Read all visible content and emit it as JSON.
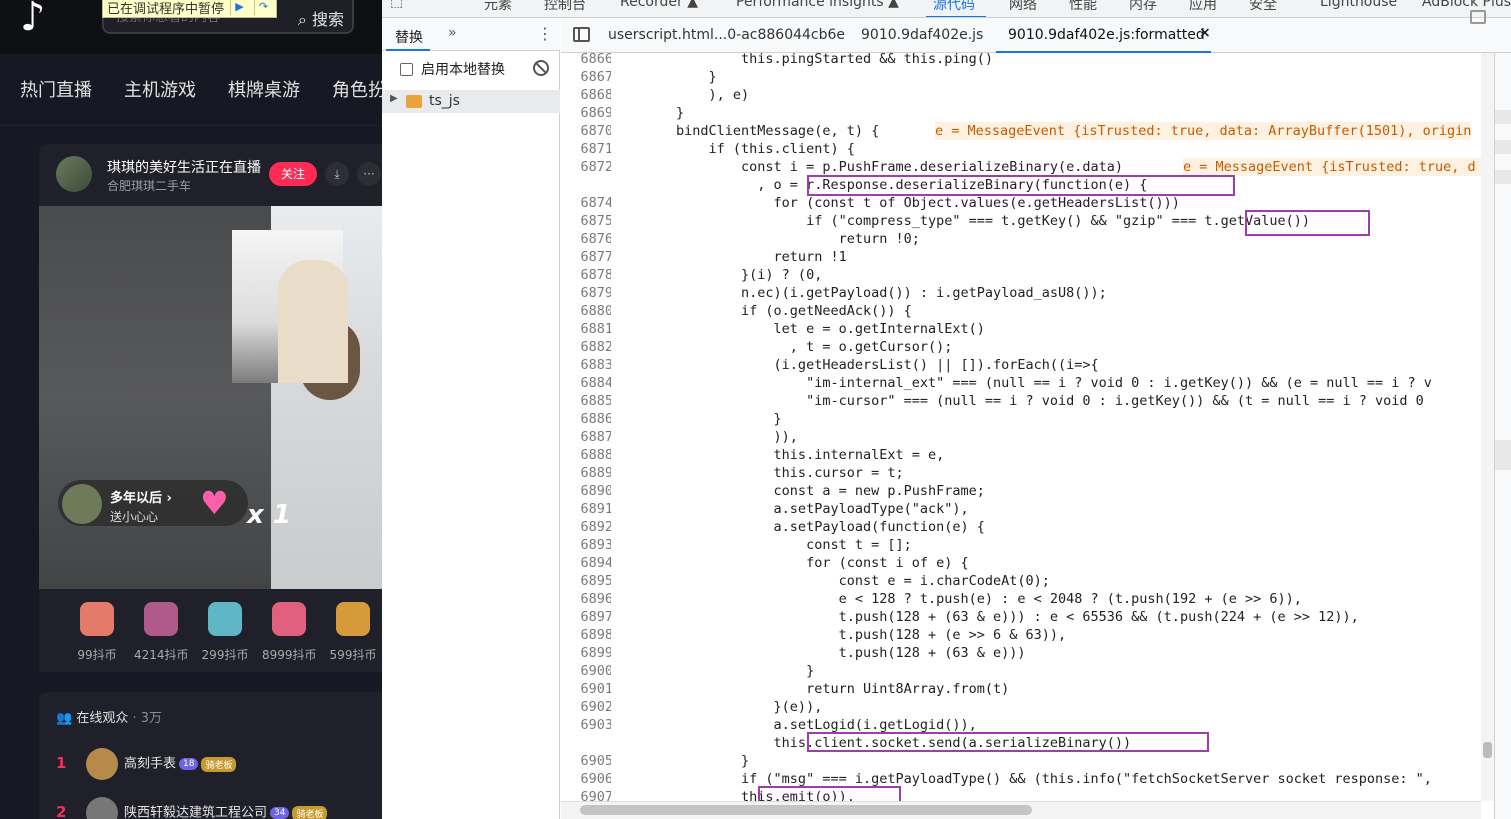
{
  "douyin": {
    "search_placeholder": "搜索你想看的内容",
    "search_button": "搜索",
    "debugger_paused": "已在调试程序中暂停",
    "categories": [
      "热门直播",
      "主机游戏",
      "棋牌桌游",
      "角色扮"
    ],
    "anchor_name": "琪琪的美好生活正在直播",
    "anchor_sub": "合肥琪琪二手车",
    "follow": "关注",
    "gift_bubble": {
      "name": "多年以后 ›",
      "sub": "送小心心",
      "multiplier": "x 1"
    },
    "gifts": [
      "99抖币",
      "4214抖币",
      "299抖币",
      "8999抖币",
      "599抖币"
    ],
    "audience_title": "在线观众",
    "audience_count": "· 3万",
    "audience": [
      {
        "rank": "1",
        "name": "高刻手表",
        "lv": "18",
        "badge": "骑老板"
      },
      {
        "rank": "2",
        "name": "陕西轩毅达建筑工程公司",
        "lv": "34",
        "badge": "骑老板"
      }
    ]
  },
  "devtools": {
    "top_tabs": [
      "元素",
      "控制台",
      "Recorder ▲",
      "Performance insights ▲",
      "源代码",
      "网络",
      "性能",
      "内存",
      "应用",
      "安全",
      "Lighthouse",
      "AdBlock Plus"
    ],
    "active_top_tab": "源代码",
    "navigator": {
      "tab": "替换",
      "more": "»",
      "enable_override": "启用本地替换",
      "folder": "ts_js"
    },
    "file_tabs": [
      "userscript.html...0-ac886044cb6e",
      "9010.9daf402e.js",
      "9010.9daf402e.js:formatted"
    ],
    "close_glyph": "×",
    "inline_values": {
      "6870": "e = MessageEvent {isTrusted: true, data: ArrayBuffer(1501), origin",
      "6872": "e = MessageEvent {isTrusted: true, d"
    },
    "breakpoints": [
      "6873",
      "6904"
    ],
    "code_lines": [
      {
        "n": "6866",
        "t": "                this.pingStarted && this.ping()"
      },
      {
        "n": "6867",
        "t": "            }"
      },
      {
        "n": "6868",
        "t": "            ), e)"
      },
      {
        "n": "6869",
        "t": "        }"
      },
      {
        "n": "6870",
        "t": "        bindClientMessage(e, t) {"
      },
      {
        "n": "6871",
        "t": "            if (this.client) {"
      },
      {
        "n": "6872",
        "t": "                const i = p.PushFrame.deserializeBinary(e.data)"
      },
      {
        "n": "6873",
        "t": "                  , o = r.Response.deserializeBinary(function(e) {"
      },
      {
        "n": "6874",
        "t": "                    for (const t of Object.values(e.getHeadersList()))"
      },
      {
        "n": "6875",
        "t": "                        if (\"compress_type\" === t.getKey() && \"gzip\" === t.getValue())"
      },
      {
        "n": "6876",
        "t": "                            return !0;"
      },
      {
        "n": "6877",
        "t": "                    return !1"
      },
      {
        "n": "6878",
        "t": "                }(i) ? (0,"
      },
      {
        "n": "6879",
        "t": "                n.ec)(i.getPayload()) : i.getPayload_asU8());"
      },
      {
        "n": "6880",
        "t": "                if (o.getNeedAck()) {"
      },
      {
        "n": "6881",
        "t": "                    let e = o.getInternalExt()"
      },
      {
        "n": "6882",
        "t": "                      , t = o.getCursor();"
      },
      {
        "n": "6883",
        "t": "                    (i.getHeadersList() || []).forEach((i=>{"
      },
      {
        "n": "6884",
        "t": "                        \"im-internal_ext\" === (null == i ? void 0 : i.getKey()) && (e = null == i ? v"
      },
      {
        "n": "6885",
        "t": "                        \"im-cursor\" === (null == i ? void 0 : i.getKey()) && (t = null == i ? void 0"
      },
      {
        "n": "6886",
        "t": "                    }"
      },
      {
        "n": "6887",
        "t": "                    )),"
      },
      {
        "n": "6888",
        "t": "                    this.internalExt = e,"
      },
      {
        "n": "6889",
        "t": "                    this.cursor = t;"
      },
      {
        "n": "6890",
        "t": "                    const a = new p.PushFrame;"
      },
      {
        "n": "6891",
        "t": "                    a.setPayloadType(\"ack\"),"
      },
      {
        "n": "6892",
        "t": "                    a.setPayload(function(e) {"
      },
      {
        "n": "6893",
        "t": "                        const t = [];"
      },
      {
        "n": "6894",
        "t": "                        for (const i of e) {"
      },
      {
        "n": "6895",
        "t": "                            const e = i.charCodeAt(0);"
      },
      {
        "n": "6896",
        "t": "                            e < 128 ? t.push(e) : e < 2048 ? (t.push(192 + (e >> 6)),"
      },
      {
        "n": "6897",
        "t": "                            t.push(128 + (63 & e))) : e < 65536 && (t.push(224 + (e >> 12)),"
      },
      {
        "n": "6898",
        "t": "                            t.push(128 + (e >> 6 & 63)),"
      },
      {
        "n": "6899",
        "t": "                            t.push(128 + (63 & e)))"
      },
      {
        "n": "6900",
        "t": "                        }"
      },
      {
        "n": "6901",
        "t": "                        return Uint8Array.from(t)"
      },
      {
        "n": "6902",
        "t": "                    }(e)),"
      },
      {
        "n": "6903",
        "t": "                    a.setLogid(i.getLogid()),"
      },
      {
        "n": "6904",
        "t": "                    this.client.socket.send(a.serializeBinary())"
      },
      {
        "n": "6905",
        "t": "                }"
      },
      {
        "n": "6906",
        "t": "                if (\"msg\" === i.getPayloadType() && (this.info(\"fetchSocketServer socket response: \","
      },
      {
        "n": "6907",
        "t": "                this.emit(o)),"
      }
    ],
    "colors": {
      "accent": "#1a73e8",
      "annotation_box": "#a13caf",
      "inline_value": "#c75b00"
    }
  }
}
